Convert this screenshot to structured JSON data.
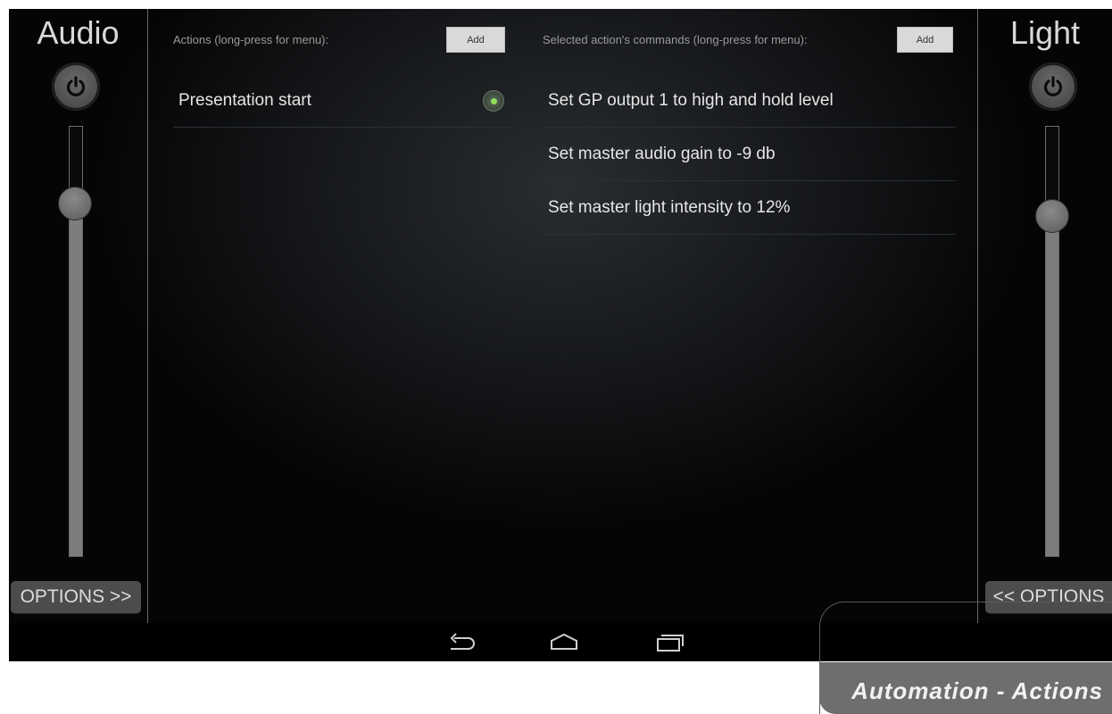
{
  "audio_panel": {
    "title": "Audio",
    "power_icon": "power-icon",
    "slider_level_pct": 82,
    "options_label": "OPTIONS >>"
  },
  "light_panel": {
    "title": "Light",
    "power_icon": "power-icon",
    "slider_level_pct": 79,
    "options_label": "<< OPTIONS"
  },
  "actions": {
    "header": "Actions (long-press for menu):",
    "add_label": "Add",
    "items": [
      {
        "label": "Presentation start",
        "selected": true
      }
    ]
  },
  "commands": {
    "header": "Selected action's commands (long-press for menu):",
    "add_label": "Add",
    "items": [
      {
        "label": "Set GP output 1 to high and hold level"
      },
      {
        "label": "Set master audio gain to -9 db"
      },
      {
        "label": "Set master light intensity to 12%"
      }
    ]
  },
  "navbar": {
    "icons": [
      "back-icon",
      "home-icon",
      "recent-apps-icon"
    ]
  },
  "caption": {
    "text": "Automation - Actions"
  },
  "colors": {
    "radio_selected": "#8fe05a",
    "slider_fill": "#7d7d7d"
  }
}
